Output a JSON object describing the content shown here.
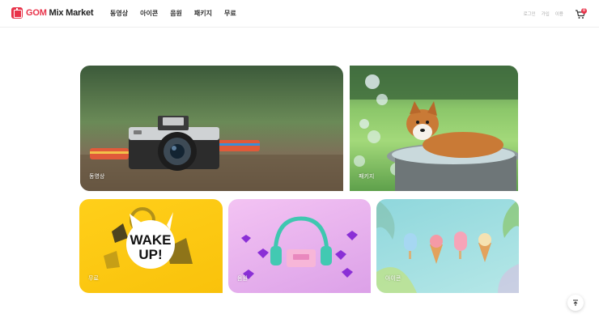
{
  "brand": {
    "name_prefix": "GOM",
    "name_suffix": "Mix Market",
    "accent": "#e8334a"
  },
  "nav": {
    "items": [
      "동영상",
      "아이콘",
      "음원",
      "패키지",
      "무료"
    ]
  },
  "util": {
    "items": [
      "로그인",
      "가입",
      "이용"
    ]
  },
  "cart": {
    "badge_count": "0"
  },
  "tiles": {
    "video": {
      "label": "동영상"
    },
    "package": {
      "label": "패키지"
    },
    "free": {
      "label": "무료",
      "sticker_text": "WAKE UP!"
    },
    "audio": {
      "label": "음원"
    },
    "icon": {
      "label": "아이콘"
    }
  },
  "icons": {
    "cart": "cart-icon",
    "scroll_top": "arrow-up-icon",
    "logo": "gom-logo-icon"
  }
}
